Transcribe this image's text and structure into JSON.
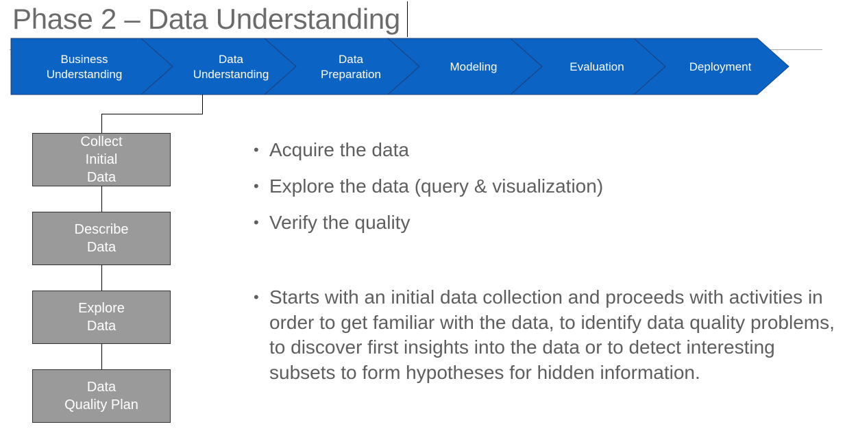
{
  "title": "Phase 2 – Data Understanding",
  "colors": {
    "phase_fill": "#0b63c4",
    "phase_outline": "#1f3f78",
    "step_fill": "#9a9a9a",
    "bullet_text": "#5e5e5e",
    "title_text": "#6b6b6b"
  },
  "process": {
    "phases": [
      {
        "label": "Business\nUnderstanding"
      },
      {
        "label": "Data\nUnderstanding"
      },
      {
        "label": "Data\nPreparation"
      },
      {
        "label": "Modeling"
      },
      {
        "label": "Evaluation"
      },
      {
        "label": "Deployment"
      }
    ],
    "active_phase": "Data\nUnderstanding"
  },
  "steps": [
    {
      "label": "Collect\nInitial\nData"
    },
    {
      "label": "Describe\nData"
    },
    {
      "label": "Explore\nData"
    },
    {
      "label": "Data\nQuality Plan"
    }
  ],
  "bullets": [
    {
      "text": "Acquire the data"
    },
    {
      "text": "Explore the data (query & visualization)"
    },
    {
      "text": "Verify the quality"
    },
    {
      "text": "Starts with an initial data collection and proceeds with activities in order to get familiar with the data, to identify data quality problems, to discover first insights into the data or to detect interesting subsets to form hypotheses for hidden information."
    }
  ]
}
